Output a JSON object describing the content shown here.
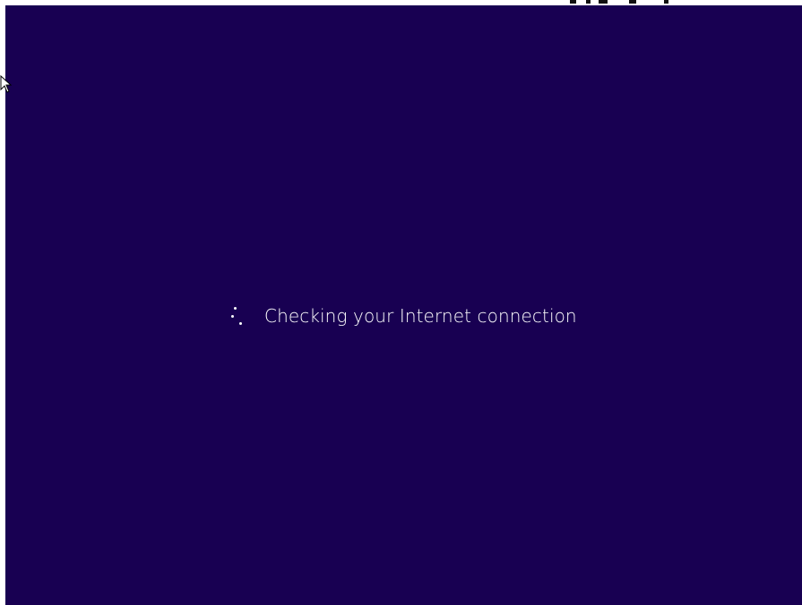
{
  "status": {
    "message": "Checking your Internet connection",
    "spinner_icon": "loading-spinner-icon"
  },
  "screen": {
    "background": "#180052",
    "text_color": "#ffffff"
  },
  "cursor": {
    "icon": "mouse-pointer-icon"
  }
}
